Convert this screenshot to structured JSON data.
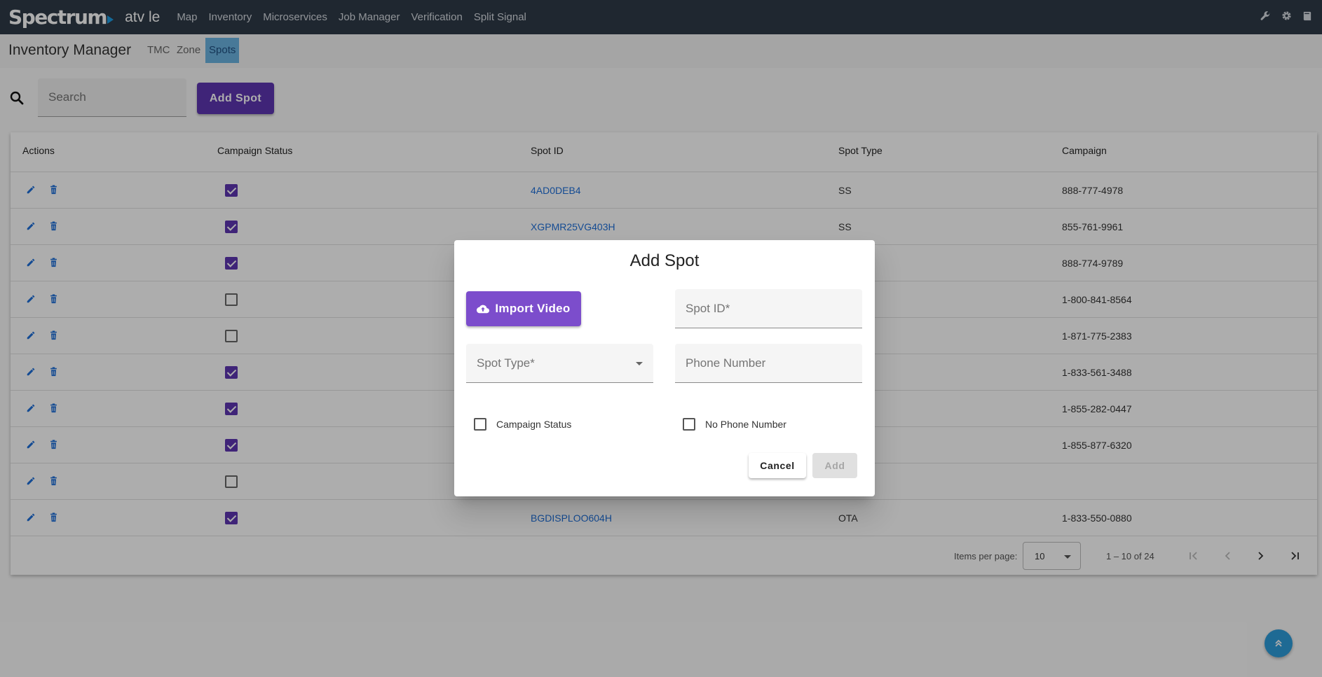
{
  "nav": {
    "logo": "Spectrum",
    "sub": "atv le",
    "links": [
      "Map",
      "Inventory",
      "Microservices",
      "Job Manager",
      "Verification",
      "Split Signal"
    ],
    "icons": [
      "wrench-icon",
      "gear-icon",
      "book-icon"
    ]
  },
  "subheader": {
    "title": "Inventory Manager",
    "tabs": [
      "TMC",
      "Zone",
      "Spots"
    ],
    "active_tab": "Spots"
  },
  "toolbar": {
    "search_placeholder": "Search",
    "add_label": "Add Spot"
  },
  "table": {
    "headers": [
      "Actions",
      "Campaign Status",
      "Spot ID",
      "Spot Type",
      "Campaign"
    ],
    "rows": [
      {
        "checked": true,
        "spot_id": "4AD0DEB4",
        "spot_type": "SS",
        "campaign": "888-777-4978"
      },
      {
        "checked": true,
        "spot_id": "XGPMR25VG403H",
        "spot_type": "SS",
        "campaign": "855-761-9961"
      },
      {
        "checked": true,
        "spot_id": "",
        "spot_type": "",
        "campaign": "888-774-9789"
      },
      {
        "checked": false,
        "spot_id": "",
        "spot_type": "",
        "campaign": "1-800-841-8564"
      },
      {
        "checked": false,
        "spot_id": "",
        "spot_type": "",
        "campaign": "1-871-775-2383"
      },
      {
        "checked": true,
        "spot_id": "",
        "spot_type": "",
        "campaign": "1-833-561-3488"
      },
      {
        "checked": true,
        "spot_id": "",
        "spot_type": "",
        "campaign": "1-855-282-0447"
      },
      {
        "checked": true,
        "spot_id": "",
        "spot_type": "",
        "campaign": "1-855-877-6320"
      },
      {
        "checked": false,
        "spot_id": "",
        "spot_type": "",
        "campaign": ""
      },
      {
        "checked": true,
        "spot_id": "BGDISPLOO604H",
        "spot_type": "OTA",
        "campaign": "1-833-550-0880"
      }
    ]
  },
  "pagination": {
    "items_label": "Items per page:",
    "per_page": "10",
    "range": "1 – 10 of 24"
  },
  "dialog": {
    "title": "Add Spot",
    "import_label": "Import Video",
    "spot_id_placeholder": "Spot ID*",
    "spot_type_placeholder": "Spot Type*",
    "phone_placeholder": "Phone Number",
    "campaign_status_label": "Campaign Status",
    "no_phone_label": "No Phone Number",
    "cancel_label": "Cancel",
    "add_label": "Add"
  },
  "colors": {
    "nav_bg": "#2e3a48",
    "primary": "#5e35b1",
    "link": "#1e6fd9",
    "active_tab": "#6bb3e0",
    "fab": "#2d9cdb"
  }
}
